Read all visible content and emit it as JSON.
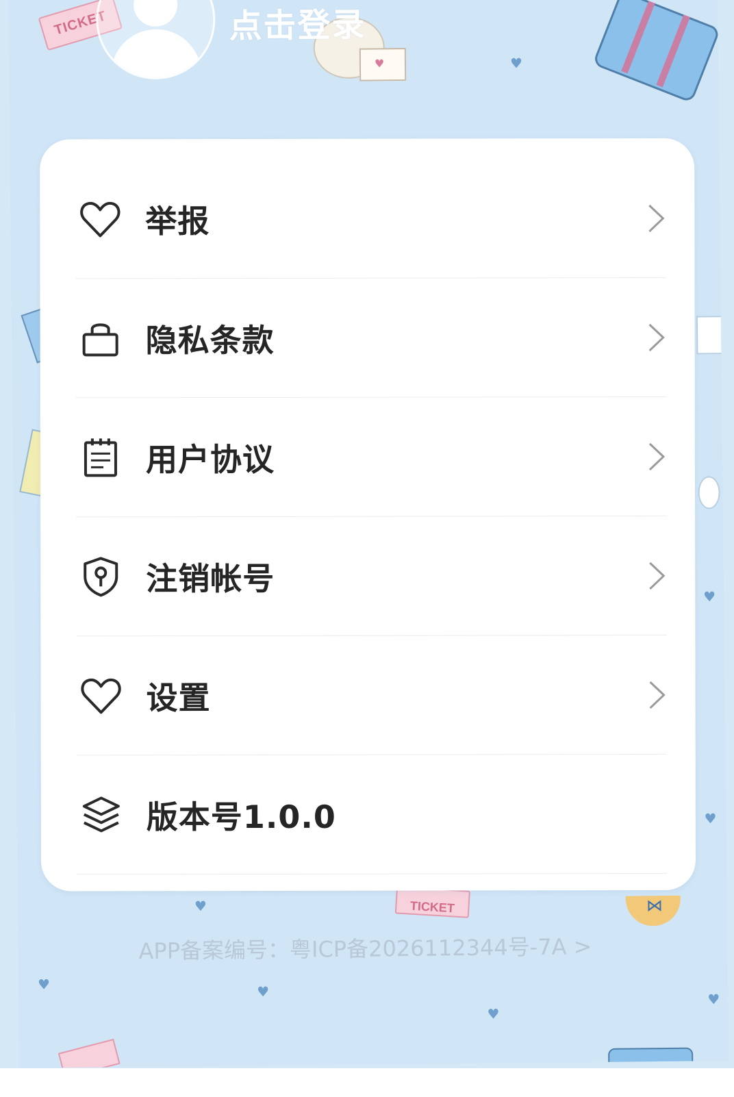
{
  "header": {
    "login_label": "点击登录"
  },
  "menu": {
    "items": [
      {
        "label": "举报",
        "icon": "heart-icon"
      },
      {
        "label": "隐私条款",
        "icon": "lock-icon"
      },
      {
        "label": "用户协议",
        "icon": "notepad-icon"
      },
      {
        "label": "注销帐号",
        "icon": "shield-key-icon"
      },
      {
        "label": "设置",
        "icon": "heart-icon"
      },
      {
        "label": "版本号1.0.0",
        "icon": "layers-icon"
      }
    ]
  },
  "footer": {
    "icp_text": "APP备案编号：粤ICP备2026112344号-7A >"
  },
  "decor": {
    "ticket_text": "TICKET"
  },
  "colors": {
    "background": "#d0e6f7",
    "card": "#ffffff",
    "text": "#252525",
    "icp_text": "#b8c8d6"
  }
}
